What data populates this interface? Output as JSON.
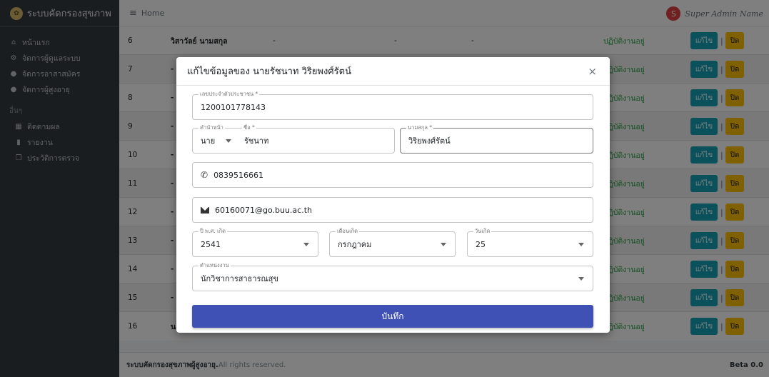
{
  "brand": {
    "title": "ระบบคัดกรองสุขภาพ"
  },
  "sidebar": {
    "items": [
      {
        "label": "หน้าแรก",
        "icon": "home-icon"
      },
      {
        "label": "จัดการผู้ดูแลระบบ",
        "icon": "users-cog-icon"
      },
      {
        "label": "จัดการอาสาสมัคร",
        "icon": "user-cog-icon"
      },
      {
        "label": "จัดการผู้สูงอายุ",
        "icon": "users-icon"
      }
    ],
    "header": "อื่นๆ",
    "sub_items": [
      {
        "label": "ติดตามผล",
        "icon": "calendar-icon"
      },
      {
        "label": "รายงาน",
        "icon": "file-icon"
      },
      {
        "label": "ประวัติการตรวจ",
        "icon": "copy-icon"
      }
    ]
  },
  "topbar": {
    "home": "Home",
    "user_initial": "S",
    "user_name": "Super Admin Name"
  },
  "table": {
    "edit_label": "แก้ไข",
    "close_label": "ปิด",
    "status_label": "ปฏิบัติงานอยู่",
    "rows": [
      {
        "no": "6",
        "name": "วิสาวัลย์ นามสกุล",
        "pos": "-",
        "phone": "-",
        "mail": "-"
      },
      {
        "no": "7",
        "name": "-",
        "pos": "",
        "phone": "",
        "mail": ""
      },
      {
        "no": "8",
        "name": "-",
        "pos": "",
        "phone": "",
        "mail": ""
      },
      {
        "no": "9",
        "name": "-",
        "pos": "",
        "phone": "",
        "mail": ""
      },
      {
        "no": "10",
        "name": "-",
        "pos": "",
        "phone": "",
        "mail": ""
      },
      {
        "no": "11",
        "name": "-",
        "pos": "",
        "phone": "",
        "mail": ""
      },
      {
        "no": "12",
        "name": "-",
        "pos": "",
        "phone": "",
        "mail": ""
      },
      {
        "no": "13",
        "name": "-",
        "pos": "",
        "phone": "",
        "mail": ""
      },
      {
        "no": "14",
        "name": "-",
        "pos": "",
        "phone": "",
        "mail": ""
      },
      {
        "no": "15",
        "name": "-",
        "pos": "",
        "phone": "",
        "mail": ""
      },
      {
        "no": "16",
        "name": "นายรัชนาท วิริยพงศ์รัตน์",
        "pos": "นักวิชาการสาธารณสุข",
        "phone": "0839516661",
        "mail": "60160071@go.buu.ac.th"
      }
    ]
  },
  "footer": {
    "brand": "ระบบคัดกรองสุขภาพผู้สูงอายุ.",
    "rights": "All rights reserved.",
    "version": "Beta 0.0"
  },
  "modal": {
    "title": "แก้ไขข้อมูลของ นายรัชนาท วิริยพงศ์รัตน์",
    "close": "×",
    "id_card": {
      "label": "เลขประจำตัวประชาชน *",
      "value": "1200101778143"
    },
    "prefix": {
      "label": "คำนำหน้า",
      "value": "นาย"
    },
    "firstname": {
      "label": "ชื่อ *",
      "value": "รัชนาท"
    },
    "lastname": {
      "label": "นามสกุล *",
      "value": "วิริยพงศ์รัตน์"
    },
    "phone": {
      "value": "0839516661"
    },
    "email": {
      "value": "60160071@go.buu.ac.th"
    },
    "birth_year": {
      "label": "ปี พ.ศ. เกิด",
      "value": "2541"
    },
    "birth_month": {
      "label": "เดือนเกิด",
      "value": "กรกฎาคม"
    },
    "birth_day": {
      "label": "วันเกิด",
      "value": "25"
    },
    "position": {
      "label": "ตำแหน่งงาน",
      "value": "นักวิชาการสาธารณสุข"
    },
    "save": "บันทึก"
  }
}
